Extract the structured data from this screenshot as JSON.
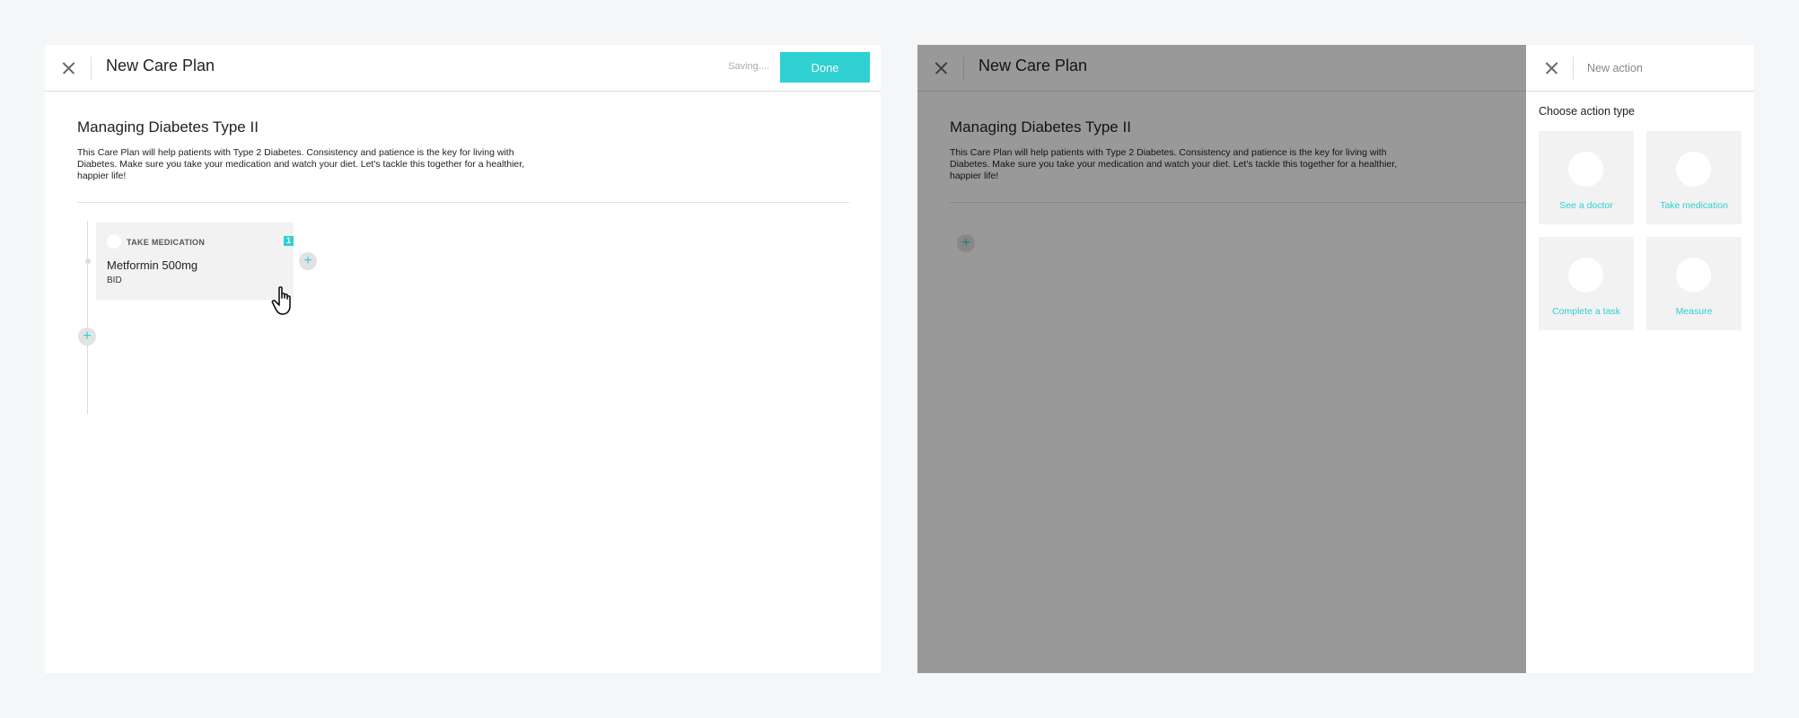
{
  "left_panel": {
    "header": {
      "title": "New Care Plan",
      "saving_text": "Saving....",
      "done_label": "Done"
    },
    "plan": {
      "heading": "Managing Diabetes Type II",
      "description": "This Care Plan will help patients with Type 2 Diabetes. Consistency and patience is the key for living with Diabetes. Make sure you take your medication and watch your diet. Let's tackle this together for a healthier, happier life!"
    },
    "card": {
      "type_label": "TAKE MEDICATION",
      "badge": "1",
      "name": "Metformin 500mg",
      "dose": "BID"
    },
    "add_symbol": "+"
  },
  "right_panel": {
    "header": {
      "title": "New Care Plan"
    },
    "plan": {
      "heading": "Managing Diabetes Type II",
      "description": "This Care Plan will help patients with Type 2 Diabetes. Consistency and patience is the key for living with Diabetes. Make sure you take your medication and watch your diet. Let's tackle this together for a healthier, happier life!"
    },
    "add_symbol": "+",
    "drawer": {
      "title": "New action",
      "choose_label": "Choose action type",
      "action_types": [
        {
          "label": "See a doctor"
        },
        {
          "label": "Take medication"
        },
        {
          "label": "Complete a task"
        },
        {
          "label": "Measure"
        }
      ]
    }
  },
  "colors": {
    "accent": "#2fd0d1",
    "background": "#f5f6f8",
    "card": "#f2f2f2",
    "overlay": "rgba(0,0,0,0.4)"
  },
  "icons": {
    "close": "close-icon",
    "add": "plus-icon",
    "cursor": "hand-pointer-icon"
  }
}
